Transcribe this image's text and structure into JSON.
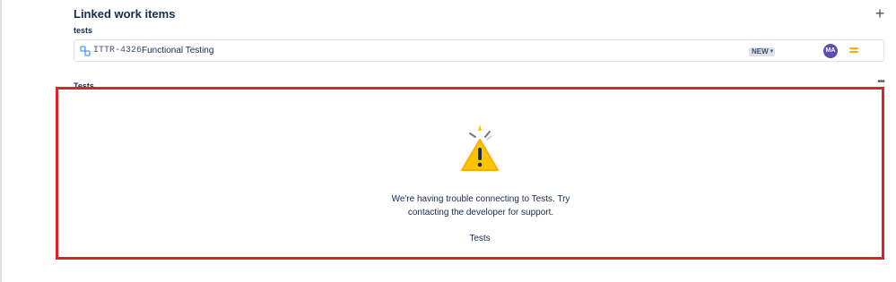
{
  "linked": {
    "title": "Linked work items",
    "add_icon": "plus-icon",
    "relation": "tests",
    "item": {
      "icon": "subtask-icon",
      "key": "ITTR-4326",
      "summary": "Functional Testing",
      "status": "NEW",
      "assignee_initials": "MA",
      "priority_icon": "priority-medium-icon",
      "colors": {
        "avatar": "#5e4db2",
        "priority": "#ffab00",
        "icon": "#4c9aff"
      }
    }
  },
  "tests_panel": {
    "title": "Tests",
    "more_icon": "more-icon",
    "error_icon": "warning-icon",
    "error_line1": "We're having trouble connecting to Tests. Try",
    "error_line2": "contacting the developer for support.",
    "app_name": "Tests",
    "highlight_color": "#d9242c"
  }
}
